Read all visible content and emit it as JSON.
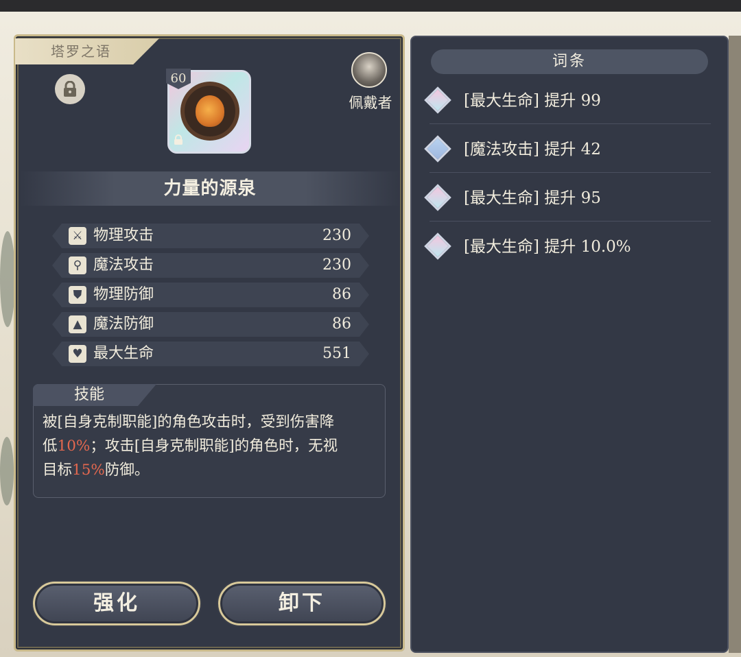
{
  "left_panel": {
    "tab_label": "塔罗之语",
    "item": {
      "level": "60",
      "name": "力量的源泉"
    },
    "wearer_label": "佩戴者",
    "stats": [
      {
        "icon": "sword-icon",
        "glyph": "⚔",
        "label": "物理攻击",
        "value": "230"
      },
      {
        "icon": "staff-icon",
        "glyph": "⚲",
        "label": "魔法攻击",
        "value": "230"
      },
      {
        "icon": "shield-icon",
        "glyph": "⛊",
        "label": "物理防御",
        "value": "86"
      },
      {
        "icon": "wizard-hat-icon",
        "glyph": "▲",
        "label": "魔法防御",
        "value": "86"
      },
      {
        "icon": "heart-icon",
        "glyph": "♥",
        "label": "最大生命",
        "value": "551"
      }
    ],
    "skill": {
      "title": "技能",
      "line1": "被[自身克制职能]的角色攻击时，受到伤害降",
      "line2_a": "低",
      "line2_hl": "10%",
      "line2_b": "；攻击[自身克制职能]的角色时，无视",
      "line3_a": "目标",
      "line3_hl": "15%",
      "line3_b": "防御。",
      "highlight_color": "#e4684f"
    },
    "buttons": {
      "enhance": "强化",
      "unequip": "卸下"
    }
  },
  "right_panel": {
    "header": "词条",
    "affixes": [
      {
        "text": "[最大生命] 提升 99",
        "gem": "pink"
      },
      {
        "text": "[魔法攻击] 提升 42",
        "gem": "blue"
      },
      {
        "text": "[最大生命] 提升 95",
        "gem": "pink"
      },
      {
        "text": "[最大生命] 提升 10.0%",
        "gem": "pink"
      }
    ]
  }
}
